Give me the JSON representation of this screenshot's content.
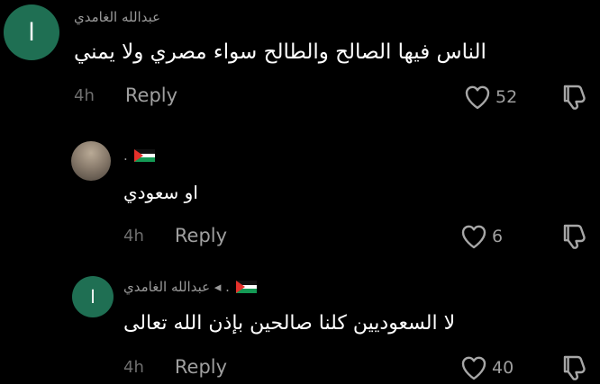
{
  "comments": [
    {
      "avatar_letter": "ا",
      "username": "عبدالله الغامدي",
      "text": "الناس فيها الصالح والطالح سواء مصري ولا يمني",
      "time": "4h",
      "reply_label": "Reply",
      "likes": "52"
    },
    {
      "username": ".",
      "text": "او سعودي",
      "time": "4h",
      "reply_label": "Reply",
      "likes": "6"
    },
    {
      "avatar_letter": "ا",
      "username": ". ◂ عبدالله الغامدي",
      "text": "لا السعوديين كلنا صالحين بإذن الله تعالى",
      "time": "4h",
      "reply_label": "Reply",
      "likes": "40"
    }
  ],
  "icons": {
    "like": "heart-outline-icon",
    "dislike": "thumbs-down-icon",
    "flag": "palestine-flag-icon"
  },
  "colors": {
    "background": "#000000",
    "avatar_green": "#1f6f53",
    "muted_text": "#9a9a9a",
    "time_text": "#6f6f6f",
    "flag_green": "#149954",
    "flag_red": "#e4312b"
  }
}
